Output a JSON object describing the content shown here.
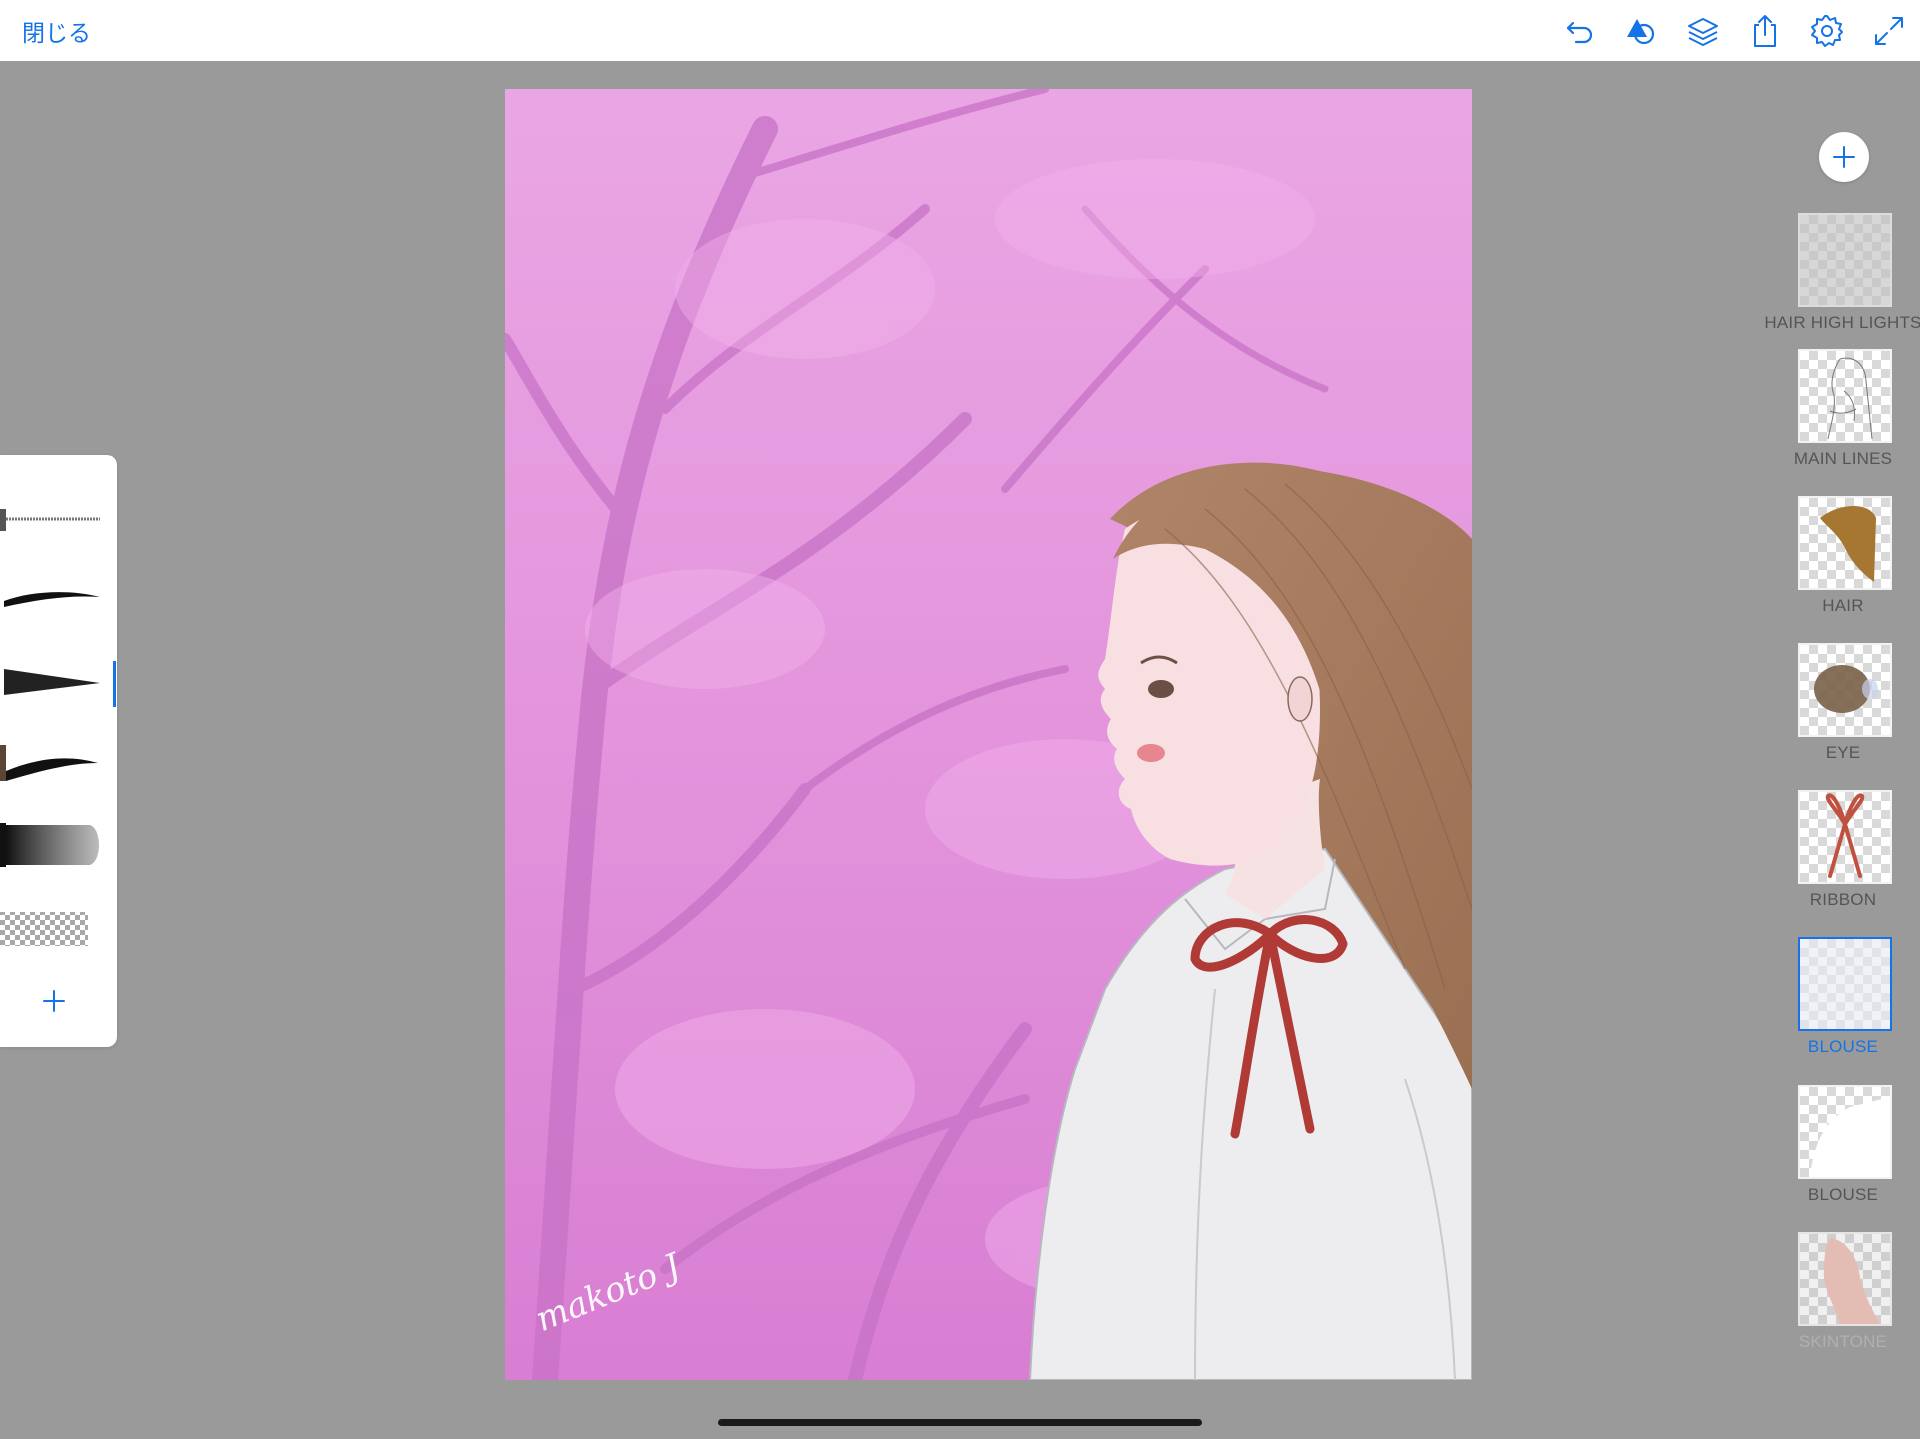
{
  "header": {
    "close_label": "閉じる",
    "tools": [
      "undo-icon",
      "shapes-icon",
      "layers-icon",
      "share-icon",
      "settings-icon",
      "fullscreen-icon"
    ]
  },
  "canvas": {
    "signature": "makoto J"
  },
  "brushes": {
    "items": [
      "pixel-line-brush",
      "tapered-ink-brush",
      "wedge-marker-brush",
      "brown-ink-brush",
      "watercolor-wash-brush",
      "eraser-brush"
    ],
    "selected_index": 2
  },
  "layers": {
    "items": [
      {
        "label": "HAIR HIGH LIGHTS"
      },
      {
        "label": "MAIN LINES"
      },
      {
        "label": "HAIR"
      },
      {
        "label": "EYE"
      },
      {
        "label": "RIBBON"
      },
      {
        "label": "BLOUSE"
      },
      {
        "label": "BLOUSE"
      },
      {
        "label": "SKINTONE"
      }
    ],
    "selected_index": 5
  },
  "colors": {
    "accent": "#1473e6",
    "background_pink": "#e79ae1",
    "hair": "#a3785a",
    "ribbon": "#b03a35",
    "blouse": "#eeeef0",
    "skin": "#f7dfe2"
  }
}
